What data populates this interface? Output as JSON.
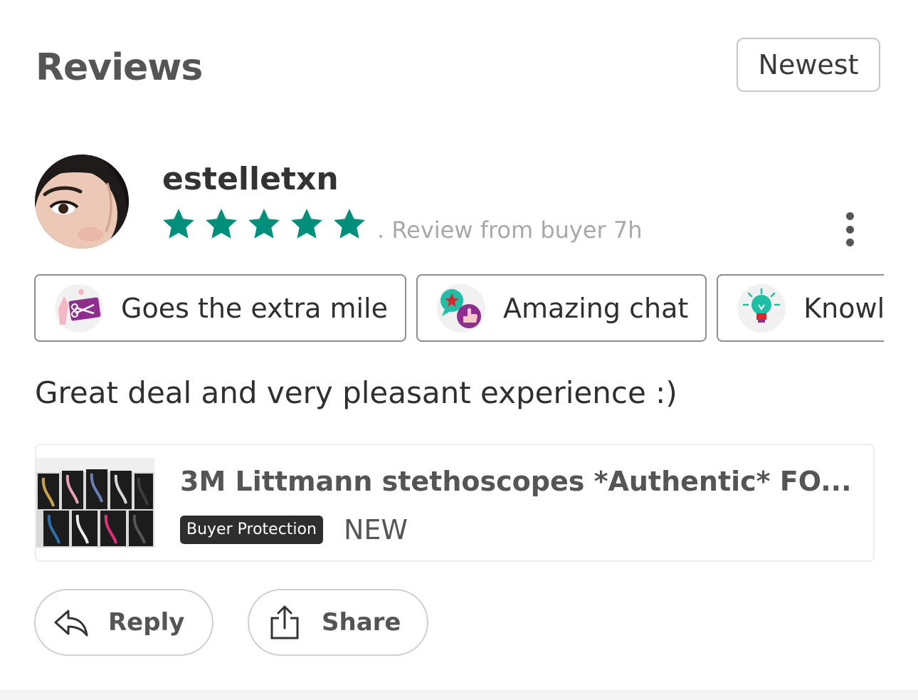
{
  "header": {
    "title": "Reviews",
    "sort_label": "Newest"
  },
  "review": {
    "username": "estelletxn",
    "rating": 5,
    "max_rating": 5,
    "meta": ". Review from buyer  7h",
    "star_color": "#008f7a",
    "badges": [
      {
        "label": "Goes the extra mile",
        "icon": "gift-card-scissors-icon"
      },
      {
        "label": "Amazing chat",
        "icon": "chat-thumbs-up-icon"
      },
      {
        "label": "Knowledgeable",
        "icon": "lightbulb-icon"
      }
    ],
    "text": "Great deal and very pleasant experience :)",
    "listing": {
      "title": "3M Littmann stethoscopes *Authentic* FO...",
      "protection_label": "Buyer Protection",
      "condition": "NEW"
    }
  },
  "actions": {
    "reply_label": "Reply",
    "share_label": "Share"
  }
}
